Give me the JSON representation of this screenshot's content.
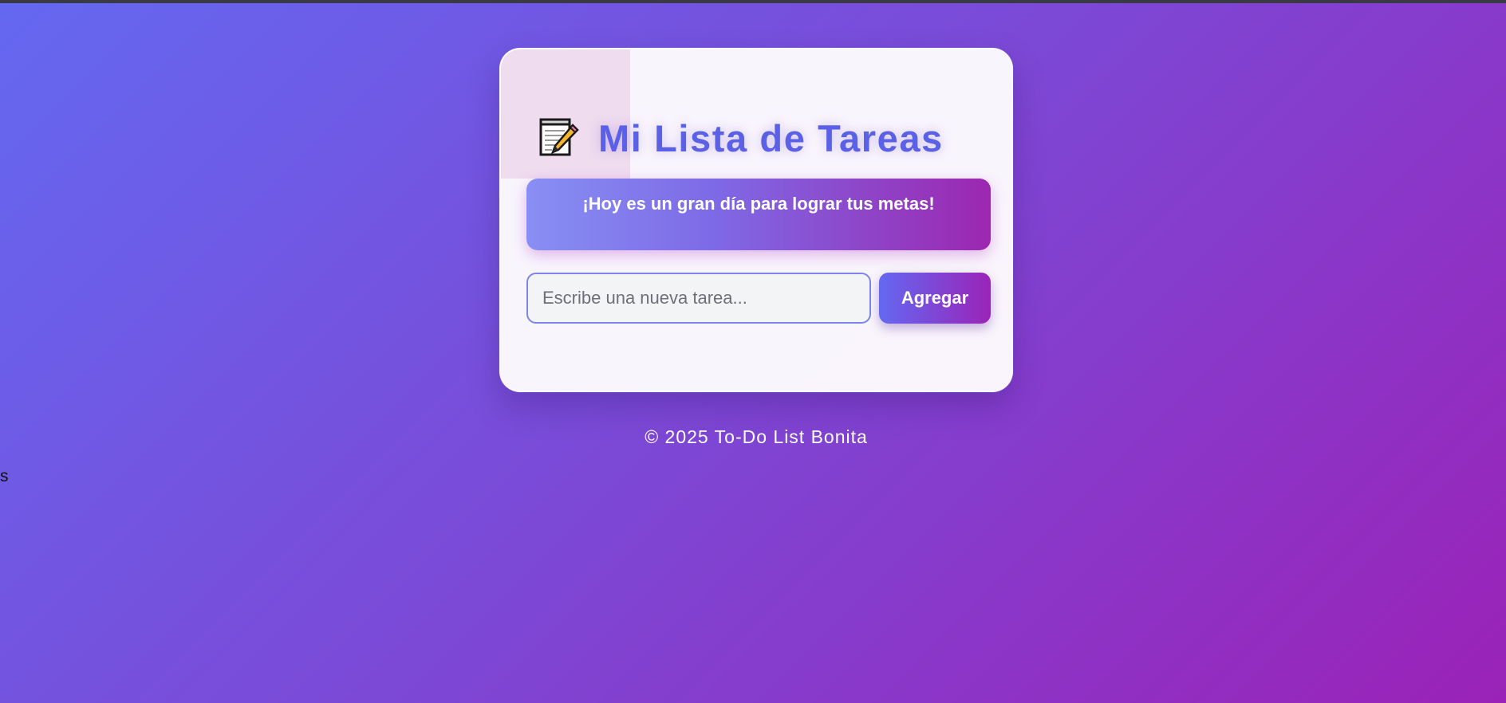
{
  "page": {
    "background_gradient": [
      "#6468f1",
      "#9b22b8"
    ]
  },
  "card": {
    "title_icon": "memo-icon",
    "title": "Mi Lista de Tareas",
    "title_color": "#5b61e6",
    "motivation": "¡Hoy es un gran día para lograr tus metas!",
    "input": {
      "placeholder": "Escribe una nueva tarea...",
      "value": ""
    },
    "add_button_label": "Agregar"
  },
  "footer": {
    "text": "© 2025 To-Do List Bonita"
  },
  "stray_text": "s"
}
